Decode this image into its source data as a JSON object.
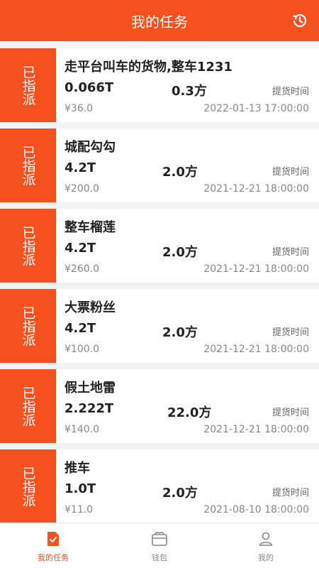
{
  "header": {
    "title": "我的任务"
  },
  "colors": {
    "accent": "#f5501e",
    "tab_inactive": "#888888"
  },
  "tasks": [
    {
      "status": "已指派",
      "title": "走平台叫车的货物,整车1231",
      "weight": "0.066T",
      "volume": "0.3方",
      "pickup_label": "提货时间",
      "price": "¥36.0",
      "time": "2022-01-13 17:00:00"
    },
    {
      "status": "已指派",
      "title": "城配勾勾",
      "weight": "4.2T",
      "volume": "2.0方",
      "pickup_label": "提货时间",
      "price": "¥200.0",
      "time": "2021-12-21 18:00:00"
    },
    {
      "status": "已指派",
      "title": "整车榴莲",
      "weight": "4.2T",
      "volume": "2.0方",
      "pickup_label": "提货时间",
      "price": "¥260.0",
      "time": "2021-12-21 18:00:00"
    },
    {
      "status": "已指派",
      "title": "大票粉丝",
      "weight": "4.2T",
      "volume": "2.0方",
      "pickup_label": "提货时间",
      "price": "¥100.0",
      "time": "2021-12-21 18:00:00"
    },
    {
      "status": "已指派",
      "title": "假土地雷",
      "weight": "2.222T",
      "volume": "22.0方",
      "pickup_label": "提货时间",
      "price": "¥140.0",
      "time": "2021-12-21 18:00:00"
    },
    {
      "status": "已指派",
      "title": "推车",
      "weight": "1.0T",
      "volume": "2.0方",
      "pickup_label": "提货时间",
      "price": "¥11.0",
      "time": "2021-08-10 18:00:00"
    }
  ],
  "tabbar": {
    "items": [
      {
        "label": "我的任务",
        "icon": "task-icon",
        "active": true
      },
      {
        "label": "钱包",
        "icon": "wallet-icon",
        "active": false
      },
      {
        "label": "我的",
        "icon": "profile-icon",
        "active": false
      }
    ]
  }
}
